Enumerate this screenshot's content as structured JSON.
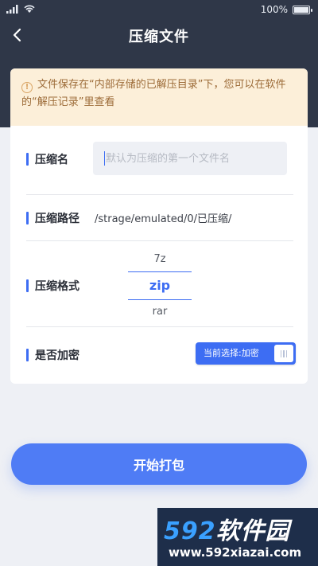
{
  "status_bar": {
    "battery": "100%"
  },
  "nav": {
    "title": "压缩文件"
  },
  "notice": {
    "text": "文件保存在“内部存储的已解压目录”下，您可以在软件的“解压记录”里查看"
  },
  "form": {
    "name_label": "压缩名",
    "name_placeholder": "默认为压缩的第一个文件名",
    "path_label": "压缩路径",
    "path_value": "/strage/emulated/0/已压缩/",
    "format_label": "压缩格式",
    "formats": [
      "7z",
      "zip",
      "rar"
    ],
    "format_selected": "zip",
    "encrypt_label": "是否加密",
    "encrypt_toggle_text": "当前选择:加密"
  },
  "actions": {
    "start_label": "开始打包"
  },
  "watermark": {
    "brand_num": "592",
    "brand_cn": "软件园",
    "url": "www.592xiazai.com"
  },
  "colors": {
    "header_bg": "#2f3748",
    "accent": "#3d6df3",
    "button": "#4f7cf5",
    "notice_bg": "#fcefd9"
  }
}
